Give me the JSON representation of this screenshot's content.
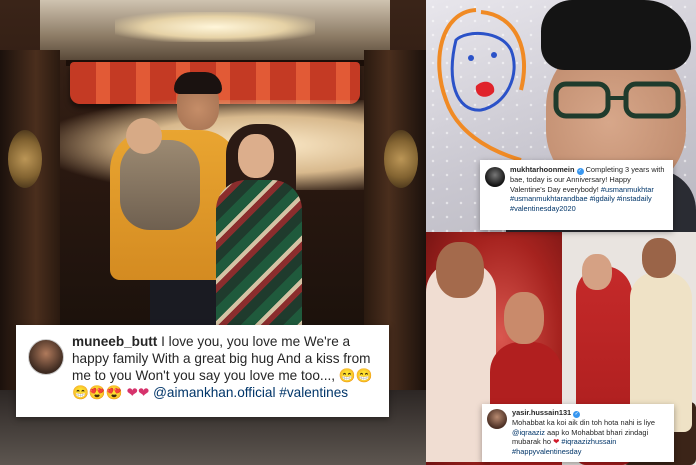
{
  "posts": [
    {
      "username": "muneeb_butt",
      "caption": "I love you, you love me We're a happy family With a great big hug And a kiss from me to you Won't you say you love me too...,",
      "emojis": "😁😁😁😍😍",
      "hearts": "❤❤",
      "mention": "@aimankhan.official",
      "hashtags": "#valentines"
    },
    {
      "username": "mukhtarhoonmein",
      "verified": true,
      "caption": "Completing 3 years with bae, today is our Anniversary! Happy Valentine's Day everybody!",
      "mention": "#usmanmukhtar",
      "hashtags": "#usmanmukhtarandbae #igdaily #instadaily #valentinesday2020"
    },
    {
      "username": "yasir.hussain131",
      "verified": true,
      "caption_line1": "Mohabbat ka koi aik din toh hota nahi is liye",
      "mention": "@iqraaziz",
      "caption_line2": "aap ko Mohabbat bhari zindagi mubarak ho",
      "heart": "❤",
      "hashtags": "#iqraazizhussain #happyvalentinesday"
    }
  ],
  "icons": {
    "verified_badge": "✓",
    "heart": "heart-icon"
  },
  "colors": {
    "hashtag": "#003569",
    "verified": "#3897f0",
    "heart": "#d6336c"
  }
}
